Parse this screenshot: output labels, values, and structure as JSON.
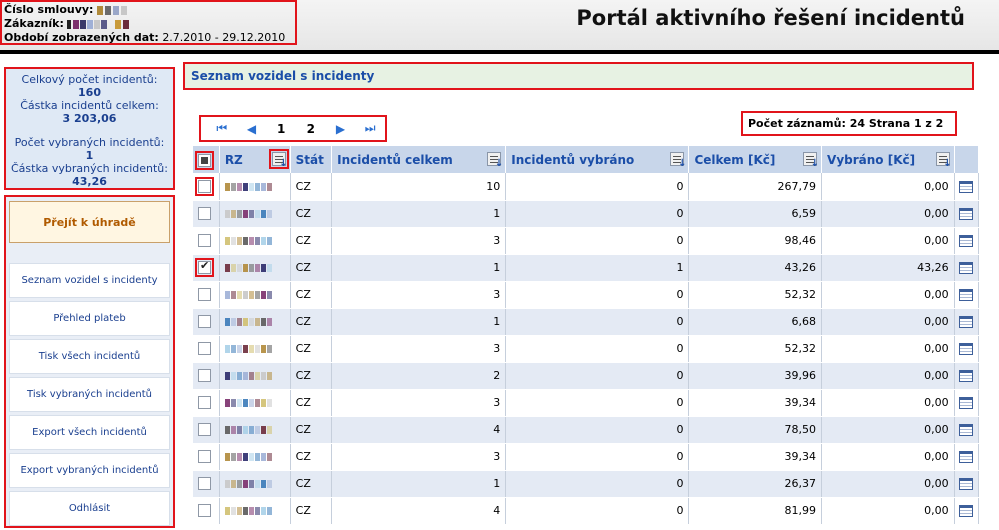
{
  "header": {
    "contract_label": "Číslo smlouvy:",
    "customer_label": "Zákazník:",
    "period_label": "Období zobrazených dat:",
    "period_value": "2.7.2010 - 29.12.2010",
    "title": "Portál aktivního řešení incidentů"
  },
  "summary": {
    "total_count_label": "Celkový počet incidentů:",
    "total_count": "160",
    "total_amount_label": "Částka incidentů celkem:",
    "total_amount": "3 203,06",
    "selected_count_label": "Počet vybraných incidentů:",
    "selected_count": "1",
    "selected_amount_label": "Částka vybraných incidentů:",
    "selected_amount": "43,26"
  },
  "nav": {
    "pay_button": "Přejít k úhradě",
    "items": [
      "Seznam vozidel s incidenty",
      "Přehled plateb",
      "Tisk všech incidentů",
      "Tisk vybraných incidentů",
      "Export všech incidentů",
      "Export vybraných incidentů",
      "Odhlásit"
    ]
  },
  "main": {
    "heading": "Seznam vozidel s incidenty",
    "pager": {
      "first": "⏮",
      "prev": "◀",
      "pages": [
        "1",
        "2"
      ],
      "next": "▶",
      "last": "⏭"
    },
    "record_count": "Počet záznamů: 24 Strana 1 z 2"
  },
  "table": {
    "columns": [
      "RZ",
      "Stát",
      "Incidentů celkem",
      "Incidentů vybráno",
      "Celkem [Kč]",
      "Vybráno [Kč]"
    ],
    "rows": [
      {
        "stat": "CZ",
        "celkem_cnt": "10",
        "vybrano_cnt": "0",
        "celkem_kc": "267,79",
        "vybrano_kc": "0,00",
        "checked": false
      },
      {
        "stat": "CZ",
        "celkem_cnt": "1",
        "vybrano_cnt": "0",
        "celkem_kc": "6,59",
        "vybrano_kc": "0,00",
        "checked": false
      },
      {
        "stat": "CZ",
        "celkem_cnt": "3",
        "vybrano_cnt": "0",
        "celkem_kc": "98,46",
        "vybrano_kc": "0,00",
        "checked": false
      },
      {
        "stat": "CZ",
        "celkem_cnt": "1",
        "vybrano_cnt": "1",
        "celkem_kc": "43,26",
        "vybrano_kc": "43,26",
        "checked": true
      },
      {
        "stat": "CZ",
        "celkem_cnt": "3",
        "vybrano_cnt": "0",
        "celkem_kc": "52,32",
        "vybrano_kc": "0,00",
        "checked": false
      },
      {
        "stat": "CZ",
        "celkem_cnt": "1",
        "vybrano_cnt": "0",
        "celkem_kc": "6,68",
        "vybrano_kc": "0,00",
        "checked": false
      },
      {
        "stat": "CZ",
        "celkem_cnt": "3",
        "vybrano_cnt": "0",
        "celkem_kc": "52,32",
        "vybrano_kc": "0,00",
        "checked": false
      },
      {
        "stat": "CZ",
        "celkem_cnt": "2",
        "vybrano_cnt": "0",
        "celkem_kc": "39,96",
        "vybrano_kc": "0,00",
        "checked": false
      },
      {
        "stat": "CZ",
        "celkem_cnt": "3",
        "vybrano_cnt": "0",
        "celkem_kc": "39,34",
        "vybrano_kc": "0,00",
        "checked": false
      },
      {
        "stat": "CZ",
        "celkem_cnt": "4",
        "vybrano_cnt": "0",
        "celkem_kc": "78,50",
        "vybrano_kc": "0,00",
        "checked": false
      },
      {
        "stat": "CZ",
        "celkem_cnt": "3",
        "vybrano_cnt": "0",
        "celkem_kc": "39,34",
        "vybrano_kc": "0,00",
        "checked": false
      },
      {
        "stat": "CZ",
        "celkem_cnt": "1",
        "vybrano_cnt": "0",
        "celkem_kc": "26,37",
        "vybrano_kc": "0,00",
        "checked": false
      },
      {
        "stat": "CZ",
        "celkem_cnt": "4",
        "vybrano_cnt": "0",
        "celkem_kc": "81,99",
        "vybrano_kc": "0,00",
        "checked": false
      }
    ]
  },
  "colors": {
    "highlight_frame": "#e1141b",
    "link_blue": "#1b4ea8",
    "header_row": "#c8d6ea",
    "alt_row": "#e4eaf4",
    "pay_text": "#b05a00"
  }
}
